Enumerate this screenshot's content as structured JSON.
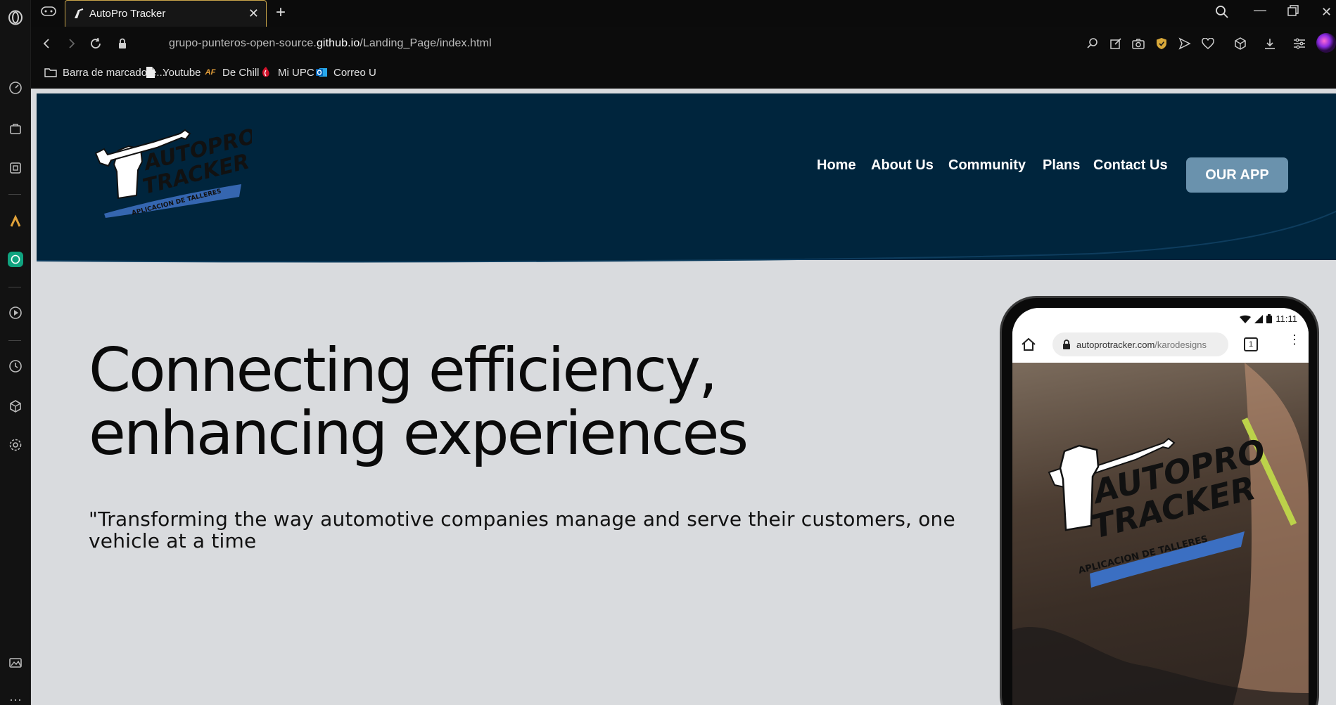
{
  "browser": {
    "tab": {
      "title": "AutoPro Tracker"
    },
    "address": {
      "url_prefix": "grupo-punteros-open-source.",
      "url_domain": "github.io",
      "url_path": "/Landing_Page/index.html"
    },
    "bookmarks": [
      {
        "label": "Barra de marcadore...",
        "icon": "folder-icon"
      },
      {
        "label": "Youtube",
        "icon": "file-icon"
      },
      {
        "label": "De Chill",
        "icon": "af-icon"
      },
      {
        "label": "Mi UPC",
        "icon": "upc-icon"
      },
      {
        "label": "Correo U",
        "icon": "outlook-icon"
      }
    ]
  },
  "site": {
    "logo": {
      "line1": "AUTOPRO",
      "line2": "TRACKER",
      "tagline": "APLICACION DE TALLERES"
    },
    "nav": [
      "Home",
      "About Us",
      "Community",
      "Plans",
      "Contact Us"
    ],
    "cta": "OUR APP",
    "hero": {
      "title_line1": "Connecting efficiency,",
      "title_line2": "enhancing experiences",
      "subtitle_line1": "\"Transforming the way automotive companies manage and serve their customers, one",
      "subtitle_line2": "vehicle at a time"
    },
    "phone": {
      "time": "11:11",
      "url_domain": "autoprotracker.com",
      "url_path": "/karodesigns",
      "tab_count": "1"
    }
  },
  "colors": {
    "header": "#00253d",
    "cta": "#6a92ad",
    "page_bg": "#d9dbde",
    "tab_accent": "#c9a54a"
  }
}
